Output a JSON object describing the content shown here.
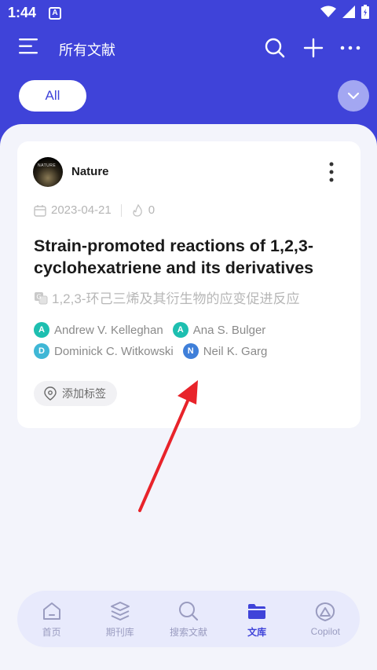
{
  "status": {
    "time": "1:44",
    "app_badge": "A"
  },
  "appbar": {
    "title": "所有文献"
  },
  "filter": {
    "chip_label": "All"
  },
  "card": {
    "journal": "Nature",
    "logo_text": "NATURE",
    "date": "2023-04-21",
    "likes": "0",
    "title": "Strain-promoted reactions of 1,2,3-cyclohexatriene and its derivatives",
    "translated_title": "1,2,3-环己三烯及其衍生物的应变促进反应",
    "authors": [
      {
        "initial": "A",
        "name": "Andrew V. Kelleghan",
        "color": "#1dbfb0"
      },
      {
        "initial": "A",
        "name": "Ana S. Bulger",
        "color": "#1dbfb0"
      },
      {
        "initial": "D",
        "name": "Dominick C. Witkowski",
        "color": "#3fb7d6"
      },
      {
        "initial": "N",
        "name": "Neil K. Garg",
        "color": "#3f7fd9"
      }
    ],
    "tag_button": "添加标签"
  },
  "nav": {
    "items": [
      {
        "label": "首页",
        "icon": "home-icon"
      },
      {
        "label": "期刊库",
        "icon": "layers-icon"
      },
      {
        "label": "搜索文献",
        "icon": "search-icon"
      },
      {
        "label": "文库",
        "icon": "folder-icon"
      },
      {
        "label": "Copilot",
        "icon": "copilot-icon"
      }
    ],
    "active_index": 3
  },
  "colors": {
    "primary": "#3f43d9",
    "annotation_arrow": "#e8232a"
  }
}
